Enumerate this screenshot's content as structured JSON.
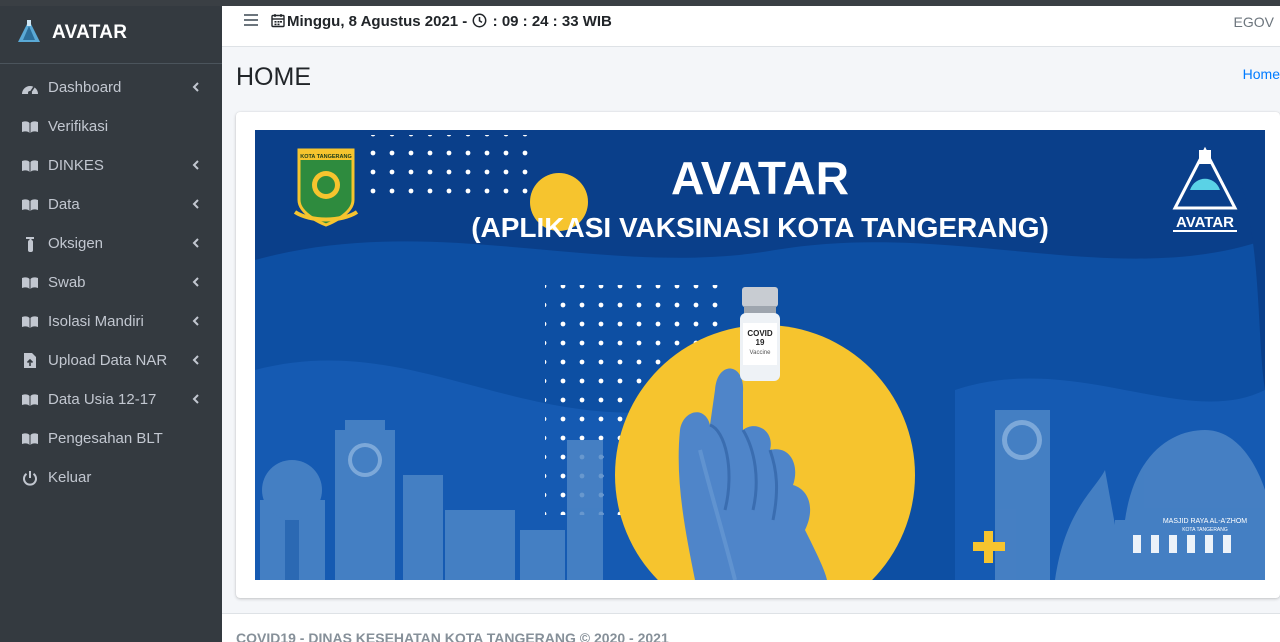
{
  "app": {
    "name": "AVATAR"
  },
  "sidebar": {
    "items": [
      {
        "label": "Dashboard",
        "icon": "dashboard-icon",
        "has_submenu": true
      },
      {
        "label": "Verifikasi",
        "icon": "book-icon",
        "has_submenu": false
      },
      {
        "label": "DINKES",
        "icon": "book-icon",
        "has_submenu": true
      },
      {
        "label": "Data",
        "icon": "book-icon",
        "has_submenu": true
      },
      {
        "label": "Oksigen",
        "icon": "oxygen-icon",
        "has_submenu": true
      },
      {
        "label": "Swab",
        "icon": "book-icon",
        "has_submenu": true
      },
      {
        "label": "Isolasi Mandiri",
        "icon": "book-icon",
        "has_submenu": true
      },
      {
        "label": "Upload Data NAR",
        "icon": "file-upload-icon",
        "has_submenu": true
      },
      {
        "label": "Data Usia 12-17",
        "icon": "book-icon",
        "has_submenu": true
      },
      {
        "label": "Pengesahan BLT",
        "icon": "book-icon",
        "has_submenu": false
      },
      {
        "label": "Keluar",
        "icon": "power-icon",
        "has_submenu": false
      }
    ]
  },
  "header": {
    "date": "Minggu, 8 Agustus 2021 -",
    "time": ": 09 : 24 : 33 WIB",
    "right_label": "EGOV"
  },
  "content": {
    "title": "HOME",
    "breadcrumb": "Home"
  },
  "banner": {
    "title": "AVATAR",
    "subtitle": "(APLIKASI VAKSINASI KOTA TANGERANG)",
    "vial_line1": "COVID",
    "vial_line2": "19",
    "vial_line3": "Vaccine",
    "emblem_text": "KOTA TANGERANG",
    "logo_text": "AVATAR",
    "mosque_text": "MASJID RAYA AL-A'ZHOM",
    "mosque_sub": "KOTA TANGERANG",
    "colors": {
      "background": "#0d4fa3",
      "accent": "#f6c42e"
    }
  },
  "footer": {
    "text": "COVID19 - DINAS KESEHATAN KOTA TANGERANG © 2020 - 2021"
  }
}
